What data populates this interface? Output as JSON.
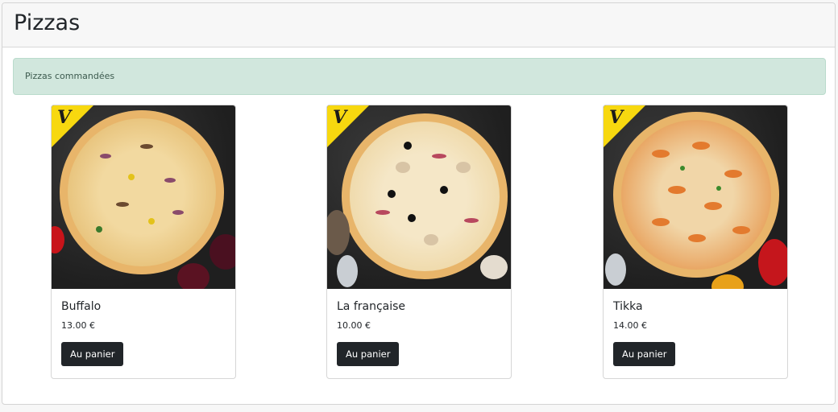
{
  "page": {
    "title": "Pizzas"
  },
  "alert": {
    "message": "Pizzas commandées"
  },
  "products": [
    {
      "name": "Buffalo",
      "price": "13.00 €",
      "button_label": "Au panier",
      "badge": "V"
    },
    {
      "name": "La française",
      "price": "10.00 €",
      "button_label": "Au panier",
      "badge": "V"
    },
    {
      "name": "Tikka",
      "price": "14.00 €",
      "button_label": "Au panier",
      "badge": "V"
    }
  ],
  "colors": {
    "accent_yellow": "#f7d80f",
    "alert_bg": "#d1e7dd",
    "button": "#212529"
  }
}
